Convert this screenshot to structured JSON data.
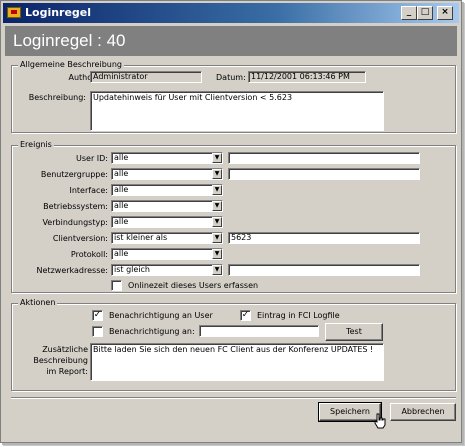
{
  "window": {
    "title": "Loginregel",
    "controls": {
      "minimize": "_",
      "maximize": "□",
      "close": "×"
    }
  },
  "header": {
    "title": "Loginregel :  40"
  },
  "general": {
    "legend": "Allgemeine Beschreibung",
    "author_label": "Author:",
    "author_value": "Administrator",
    "date_label": "Datum:",
    "date_value": "11/12/2001 06:13:46 PM",
    "description_label": "Beschreibung:",
    "description_value": "Updatehinweis für User mit Clientversion < 5.623"
  },
  "event": {
    "legend": "Ereignis",
    "rows": [
      {
        "label": "User ID:",
        "combo": "alle",
        "value": ""
      },
      {
        "label": "Benutzergruppe:",
        "combo": "alle",
        "value": ""
      },
      {
        "label": "Interface:",
        "combo": "alle"
      },
      {
        "label": "Betriebssystem:",
        "combo": "alle"
      },
      {
        "label": "Verbindungstyp:",
        "combo": "alle"
      },
      {
        "label": "Clientversion:",
        "combo": "ist kleiner als",
        "value": "5623"
      },
      {
        "label": "Protokoll:",
        "combo": "alle"
      },
      {
        "label": "Netzwerkadresse:",
        "combo": "ist gleich",
        "value": ""
      }
    ],
    "online_label": "Onlinezeit dieses Users erfassen",
    "online_checked": false
  },
  "actions": {
    "legend": "Aktionen",
    "notify_user_label": "Benachrichtigung an User",
    "notify_user_checked": true,
    "fci_log_label": "Eintrag in FCI Logfile",
    "fci_log_checked": true,
    "notify_to_label": "Benachrichtigung an:",
    "notify_to_checked": false,
    "notify_to_value": "",
    "test_label": "Test",
    "extra_label_1": "Zusätzliche",
    "extra_label_2": "Beschreibung",
    "extra_label_3": "im Report:",
    "extra_value": "Bitte laden Sie sich den neuen FC Client aus der Konferenz UPDATES !"
  },
  "buttons": {
    "save": "Speichern",
    "cancel": "Abbrechen"
  },
  "icons": {
    "check": "✓",
    "dropdown": "▼"
  }
}
